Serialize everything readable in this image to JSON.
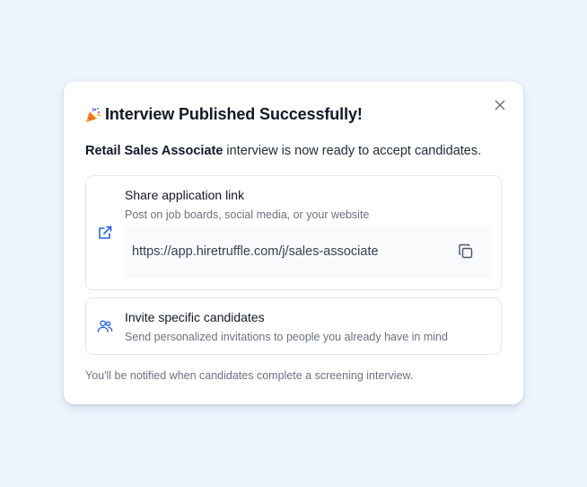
{
  "modal": {
    "title_icon": "party-popper-icon",
    "title": "Interview Published Successfully!",
    "close_icon": "close-icon",
    "subtitle_bold": "Retail Sales Associate",
    "subtitle_rest": " interview is now ready to accept candidates.",
    "share": {
      "icon": "external-link-icon",
      "title": "Share application link",
      "description": "Post on job boards, social media, or your website",
      "url": "https://app.hiretruffle.com/j/sales-associate",
      "copy_icon": "copy-icon"
    },
    "invite": {
      "icon": "users-icon",
      "title": "Invite specific candidates",
      "description": "Send personalized invitations to people you already have in mind"
    },
    "footer": "You'll be notified when candidates complete a screening interview."
  },
  "colors": {
    "background": "#eef5ff",
    "accent": "#2563eb",
    "card_border": "#e5e7eb",
    "muted_text": "#6b7280"
  }
}
